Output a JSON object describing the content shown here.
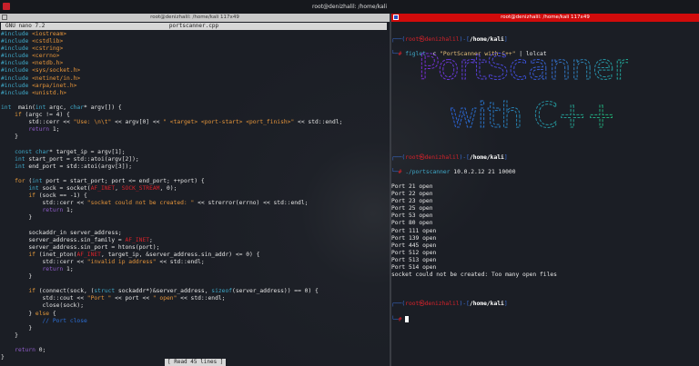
{
  "window": {
    "title": "root@denizhalil: /home/kali"
  },
  "left_pane": {
    "title": "root@denizhalil: /home/kali 117x49",
    "nano_version": "GNU nano 7.2",
    "filename": "portscanner.cpp",
    "status": "[ Read 45 lines ]",
    "code": [
      [
        [
          "pp",
          "#include "
        ],
        [
          "inc",
          "<iostream>"
        ]
      ],
      [
        [
          "pp",
          "#include "
        ],
        [
          "inc",
          "<cstdlib>"
        ]
      ],
      [
        [
          "pp",
          "#include "
        ],
        [
          "inc",
          "<cstring>"
        ]
      ],
      [
        [
          "pp",
          "#include "
        ],
        [
          "inc",
          "<cerrno>"
        ]
      ],
      [
        [
          "pp",
          "#include "
        ],
        [
          "inc",
          "<netdb.h>"
        ]
      ],
      [
        [
          "pp",
          "#include "
        ],
        [
          "inc",
          "<sys/socket.h>"
        ]
      ],
      [
        [
          "pp",
          "#include "
        ],
        [
          "inc",
          "<netinet/in.h>"
        ]
      ],
      [
        [
          "pp",
          "#include "
        ],
        [
          "inc",
          "<arpa/inet.h>"
        ]
      ],
      [
        [
          "pp",
          "#include "
        ],
        [
          "inc",
          "<unistd.h>"
        ]
      ],
      [],
      [
        [
          "kw",
          "int"
        ],
        [
          "",
          "  main("
        ],
        [
          "kw",
          "int"
        ],
        [
          "",
          " argc, "
        ],
        [
          "kw",
          "char"
        ],
        [
          "",
          "* argv[]) {"
        ]
      ],
      [
        [
          "",
          "    "
        ],
        [
          "ctl",
          "if"
        ],
        [
          "",
          " (argc != 4) {"
        ]
      ],
      [
        [
          "",
          "        std::cerr << "
        ],
        [
          "str",
          "\"Use: \\n\\t\""
        ],
        [
          "",
          " << argv[0] << "
        ],
        [
          "str",
          "\" <target> <port-start> <port_finish>\""
        ],
        [
          "",
          " << std::endl;"
        ]
      ],
      [
        [
          "",
          "        "
        ],
        [
          "ret",
          "return"
        ],
        [
          "",
          " 1;"
        ]
      ],
      [
        [
          "",
          "    }"
        ]
      ],
      [],
      [
        [
          "",
          "    "
        ],
        [
          "kw",
          "const char"
        ],
        [
          "",
          "* target_ip = argv[1];"
        ]
      ],
      [
        [
          "",
          "    "
        ],
        [
          "kw",
          "int"
        ],
        [
          "",
          " start_port = std::atoi(argv[2]);"
        ]
      ],
      [
        [
          "",
          "    "
        ],
        [
          "kw",
          "int"
        ],
        [
          "",
          " end_port = std::atoi(argv[3]);"
        ]
      ],
      [],
      [
        [
          "",
          "    "
        ],
        [
          "ctl",
          "for"
        ],
        [
          "",
          " ("
        ],
        [
          "kw",
          "int"
        ],
        [
          "",
          " port = start_port; port <= end_port; ++port) {"
        ]
      ],
      [
        [
          "",
          "        "
        ],
        [
          "kw",
          "int"
        ],
        [
          "",
          " sock = socket("
        ],
        [
          "mac",
          "AF_INET"
        ],
        [
          "",
          ", "
        ],
        [
          "mac",
          "SOCK_STREAM"
        ],
        [
          "",
          ", 0);"
        ]
      ],
      [
        [
          "",
          "        "
        ],
        [
          "ctl",
          "if"
        ],
        [
          "",
          " (sock == -1) {"
        ]
      ],
      [
        [
          "",
          "            std::cerr << "
        ],
        [
          "str",
          "\"socket could not be created: \""
        ],
        [
          "",
          " << strerror(errno) << std::endl;"
        ]
      ],
      [
        [
          "",
          "            "
        ],
        [
          "ret",
          "return"
        ],
        [
          "",
          " 1;"
        ]
      ],
      [
        [
          "",
          "        }"
        ]
      ],
      [],
      [
        [
          "",
          "        sockaddr_in server_address;"
        ]
      ],
      [
        [
          "",
          "        server_address.sin_family = "
        ],
        [
          "mac",
          "AF_INET"
        ],
        [
          "",
          ";"
        ]
      ],
      [
        [
          "",
          "        server_address.sin_port = htons(port);"
        ]
      ],
      [
        [
          "",
          "        "
        ],
        [
          "ctl",
          "if"
        ],
        [
          "",
          " (inet_pton("
        ],
        [
          "mac",
          "AF_INET"
        ],
        [
          "",
          ", target_ip, &server_address.sin_addr) <= 0) {"
        ]
      ],
      [
        [
          "",
          "            std::cerr << "
        ],
        [
          "str",
          "\"invalid ip address\""
        ],
        [
          "",
          " << std::endl;"
        ]
      ],
      [
        [
          "",
          "            "
        ],
        [
          "ret",
          "return"
        ],
        [
          "",
          " 1;"
        ]
      ],
      [
        [
          "",
          "        }"
        ]
      ],
      [],
      [
        [
          "",
          "        "
        ],
        [
          "ctl",
          "if"
        ],
        [
          "",
          " (connect(sock, ("
        ],
        [
          "kw",
          "struct"
        ],
        [
          "",
          " sockaddr*)&server_address, "
        ],
        [
          "kw",
          "sizeof"
        ],
        [
          "",
          "(server_address)) == 0) {"
        ]
      ],
      [
        [
          "",
          "            std::cout << "
        ],
        [
          "str",
          "\"Port \""
        ],
        [
          "",
          " << port << "
        ],
        [
          "str",
          "\" open\""
        ],
        [
          "",
          " << std::endl;"
        ]
      ],
      [
        [
          "",
          "            close(sock);"
        ]
      ],
      [
        [
          "",
          "        } "
        ],
        [
          "ctl",
          "else"
        ],
        [
          "",
          " {"
        ]
      ],
      [
        [
          "",
          "            "
        ],
        [
          "cm",
          "// Port close"
        ]
      ],
      [
        [
          "",
          "        }"
        ]
      ],
      [
        [
          "",
          "    }"
        ]
      ],
      [],
      [
        [
          "",
          "    "
        ],
        [
          "ret",
          "return"
        ],
        [
          "",
          " 0;"
        ]
      ],
      [
        [
          "",
          "}"
        ]
      ]
    ]
  },
  "right_pane": {
    "title": "root@denizhalil: /home/kali 117x49",
    "prompt": {
      "user": "root",
      "host": "denizhalil",
      "path": "/home/kali",
      "symbol": "#"
    },
    "cmd1": {
      "bin": "figlet",
      "args": " -c ",
      "quoted": "\"PortScanner with C++\"",
      "pipe": " | lolcat"
    },
    "art": {
      "line1": "PortScanner",
      "line2": "with C++"
    },
    "cmd2": {
      "bin": "./portscanner",
      "args": " 10.0.2.12 21 10000"
    },
    "output": [
      "Port 21 open",
      "Port 22 open",
      "Port 23 open",
      "Port 25 open",
      "Port 53 open",
      "Port 80 open",
      "Port 111 open",
      "Port 139 open",
      "Port 445 open",
      "Port 512 open",
      "Port 513 open",
      "Port 514 open",
      "socket could not be created: Too many open files"
    ]
  }
}
